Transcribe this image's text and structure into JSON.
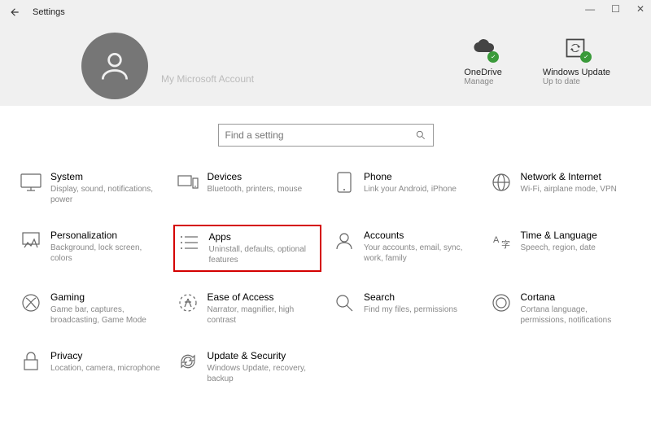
{
  "window": {
    "title": "Settings"
  },
  "profile": {
    "account_label": "My Microsoft Account"
  },
  "status": {
    "onedrive": {
      "title": "OneDrive",
      "sub": "Manage"
    },
    "update": {
      "title": "Windows Update",
      "sub": "Up to date"
    }
  },
  "search": {
    "placeholder": "Find a setting"
  },
  "tiles": {
    "system": {
      "title": "System",
      "sub": "Display, sound, notifications, power"
    },
    "devices": {
      "title": "Devices",
      "sub": "Bluetooth, printers, mouse"
    },
    "phone": {
      "title": "Phone",
      "sub": "Link your Android, iPhone"
    },
    "network": {
      "title": "Network & Internet",
      "sub": "Wi-Fi, airplane mode, VPN"
    },
    "personalization": {
      "title": "Personalization",
      "sub": "Background, lock screen, colors"
    },
    "apps": {
      "title": "Apps",
      "sub": "Uninstall, defaults, optional features"
    },
    "accounts": {
      "title": "Accounts",
      "sub": "Your accounts, email, sync, work, family"
    },
    "time": {
      "title": "Time & Language",
      "sub": "Speech, region, date"
    },
    "gaming": {
      "title": "Gaming",
      "sub": "Game bar, captures, broadcasting, Game Mode"
    },
    "ease": {
      "title": "Ease of Access",
      "sub": "Narrator, magnifier, high contrast"
    },
    "search_tile": {
      "title": "Search",
      "sub": "Find my files, permissions"
    },
    "cortana": {
      "title": "Cortana",
      "sub": "Cortana language, permissions, notifications"
    },
    "privacy": {
      "title": "Privacy",
      "sub": "Location, camera, microphone"
    },
    "update_sec": {
      "title": "Update & Security",
      "sub": "Windows Update, recovery, backup"
    }
  }
}
